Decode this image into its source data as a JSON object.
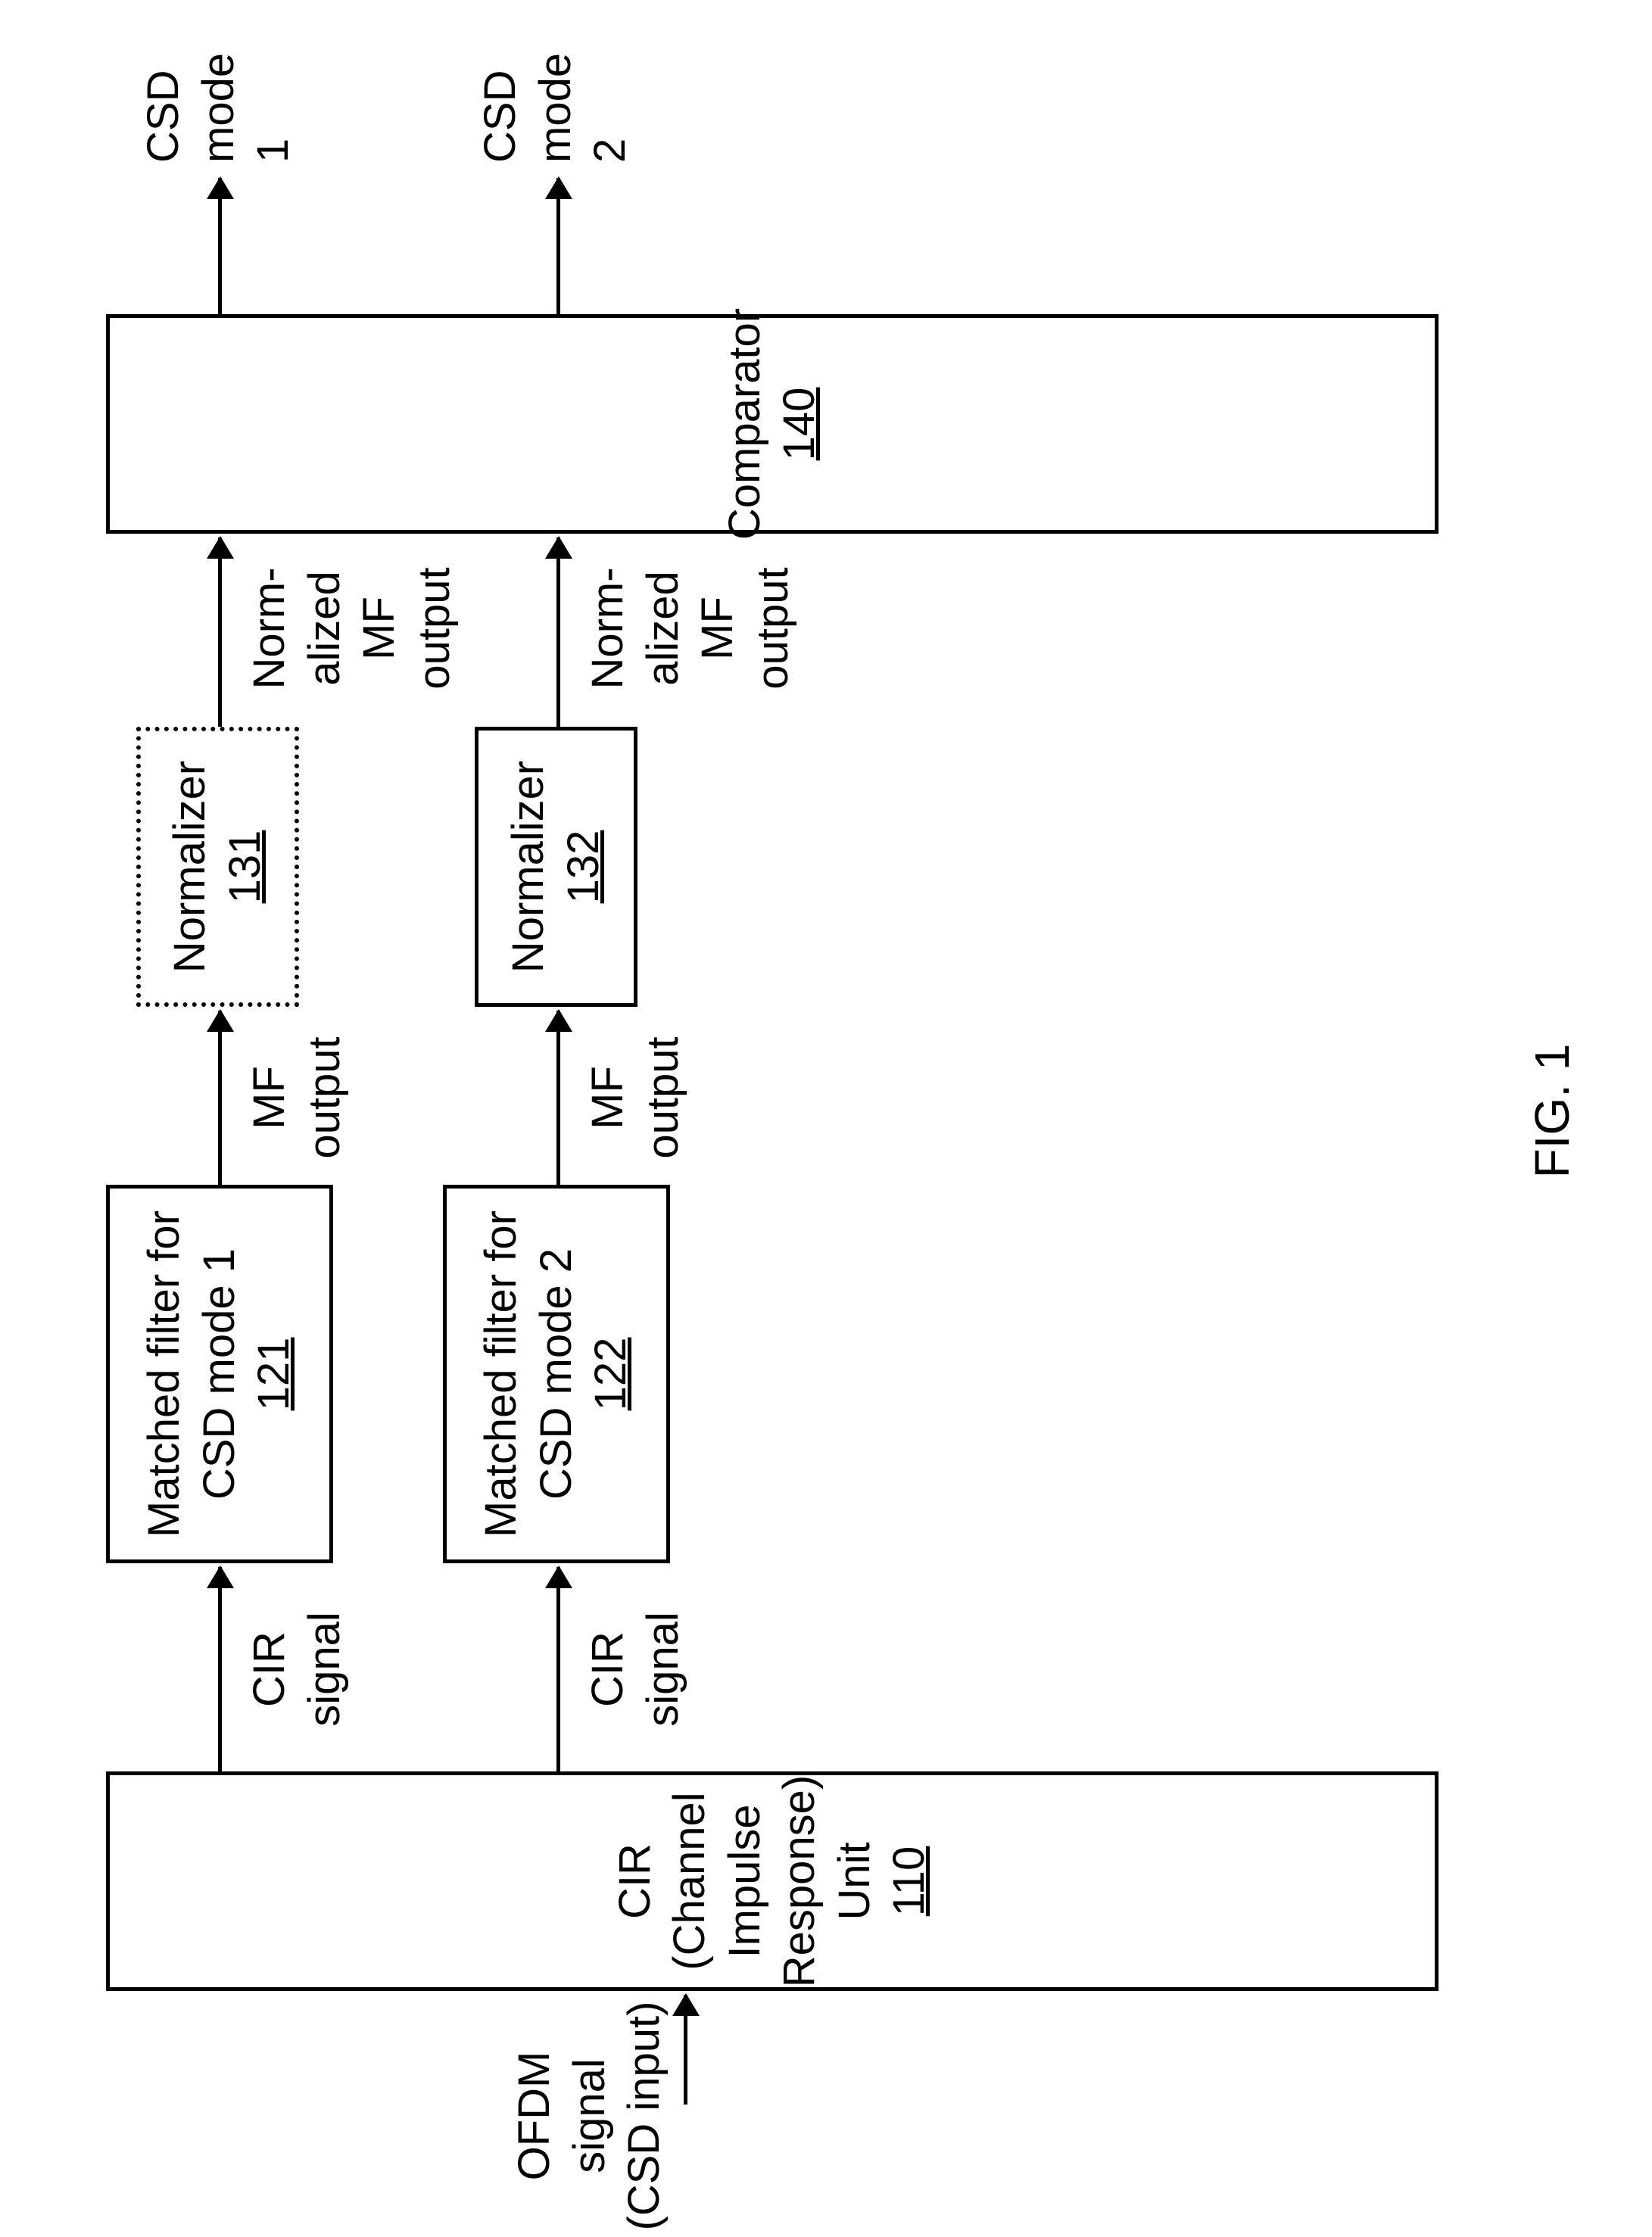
{
  "input": {
    "label": "OFDM\nsignal\n(CSD input)"
  },
  "cir_unit": {
    "label": "CIR\n(Channel\nImpulse\nResponse)\nUnit",
    "ref": "110"
  },
  "cir_signal_1": "CIR\nsignal",
  "cir_signal_2": "CIR\nsignal",
  "mf1": {
    "label": "Matched filter for\nCSD mode 1",
    "ref": "121"
  },
  "mf2": {
    "label": "Matched filter for\nCSD mode 2",
    "ref": "122"
  },
  "mf_out_1": "MF\noutput",
  "mf_out_2": "MF\noutput",
  "norm1": {
    "label": "Normalizer",
    "ref": "131"
  },
  "norm2": {
    "label": "Normalizer",
    "ref": "132"
  },
  "norm_out_1": "Norm-\nalized\nMF\noutput",
  "norm_out_2": "Norm-\nalized\nMF\noutput",
  "comparator": {
    "label": "Comparator",
    "ref": "140"
  },
  "out1": "CSD\nmode\n1",
  "out2": "CSD\nmode\n2",
  "figure_caption": "FIG. 1"
}
